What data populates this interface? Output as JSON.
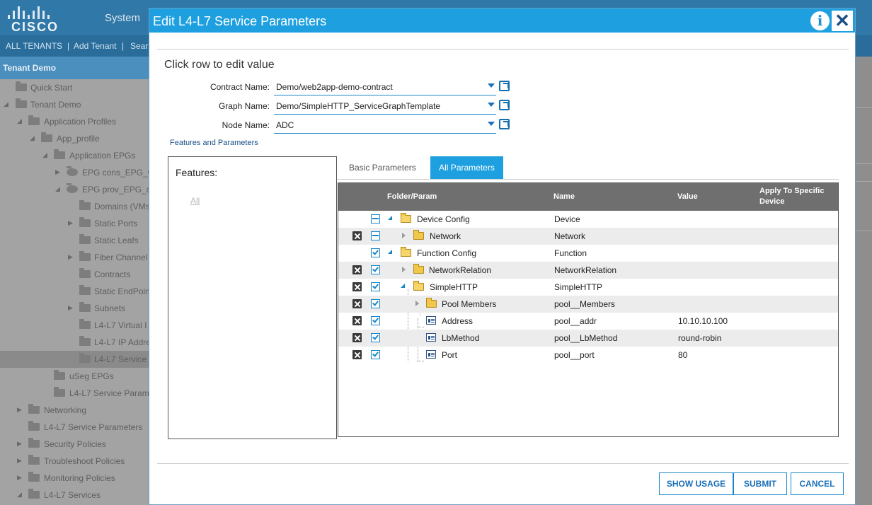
{
  "background": {
    "brand": "CISCO",
    "top_nav": {
      "system_label": "System"
    },
    "tenant_bar": {
      "all_tenants": "ALL TENANTS",
      "add_tenant": "Add Tenant",
      "search": "Sear",
      "separator": "|"
    },
    "tenant_header": "Tenant Demo",
    "nav": [
      "Quick Start",
      "Tenant Demo",
      "Application Profiles",
      "App_profile",
      "Application EPGs",
      "EPG cons_EPG_w",
      "EPG prov_EPG_a",
      "Domains (VMs",
      "Static Ports",
      "Static Leafs",
      "Fiber Channel",
      "Contracts",
      "Static EndPoin",
      "Subnets",
      "L4-L7 Virtual I",
      "L4-L7 IP Addre",
      "L4-L7 Service",
      "uSeg EPGs",
      "L4-L7 Service Param",
      "Networking",
      "L4-L7 Service Parameters",
      "Security Policies",
      "Troubleshoot Policies",
      "Monitoring Policies",
      "L4-L7 Services"
    ]
  },
  "modal": {
    "title": "Edit L4-L7 Service Parameters",
    "info_icon": "i",
    "close_icon": "✕",
    "subtitle": "Click row to edit value",
    "fields": {
      "contract": {
        "label": "Contract Name:",
        "value": "Demo/web2app-demo-contract"
      },
      "graph": {
        "label": "Graph Name:",
        "value": "Demo/SimpleHTTP_ServiceGraphTemplate"
      },
      "node": {
        "label": "Node Name:",
        "value": "ADC"
      }
    },
    "features_link": "Features and Parameters",
    "features": {
      "label": "Features:",
      "all": "All"
    },
    "tabs": {
      "basic": "Basic Parameters",
      "all": "All Parameters"
    },
    "table": {
      "columns": {
        "folder": "Folder/Param",
        "name": "Name",
        "value": "Value",
        "apply1": "Apply To Specific",
        "apply2": "Device"
      },
      "rows": [
        {
          "folder": "Device Config",
          "name": "Device",
          "value": ""
        },
        {
          "folder": "Network",
          "name": "Network",
          "value": ""
        },
        {
          "folder": "Function Config",
          "name": "Function",
          "value": ""
        },
        {
          "folder": "NetworkRelation",
          "name": "NetworkRelation",
          "value": ""
        },
        {
          "folder": "SimpleHTTP",
          "name": "SimpleHTTP",
          "value": ""
        },
        {
          "folder": "Pool Members",
          "name": "pool__Members",
          "value": ""
        },
        {
          "folder": "Address",
          "name": "pool__addr",
          "value": "10.10.10.100"
        },
        {
          "folder": "LbMethod",
          "name": "pool__LbMethod",
          "value": "round-robin"
        },
        {
          "folder": "Port",
          "name": "pool__port",
          "value": "80"
        }
      ]
    },
    "buttons": {
      "show_usage": "SHOW USAGE",
      "submit": "SUBMIT",
      "cancel": "CANCEL"
    },
    "colors": {
      "header": "#1ea0e0",
      "accent": "#1a86c8"
    }
  }
}
